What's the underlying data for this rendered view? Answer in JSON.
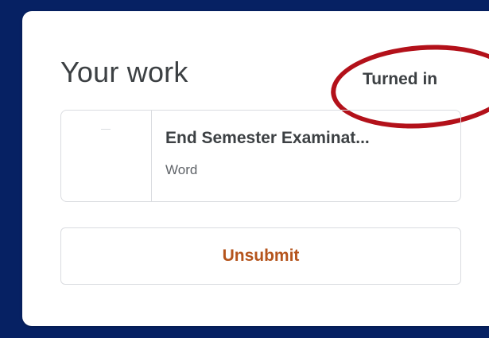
{
  "card": {
    "title": "Your work",
    "status": "Turned in"
  },
  "attachment": {
    "name": "End Semester Examinat...",
    "type": "Word"
  },
  "actions": {
    "unsubmit_label": "Unsubmit"
  },
  "colors": {
    "background": "#062163",
    "annotation_ring": "#b3111a",
    "unsubmit_text": "#b5541c"
  }
}
